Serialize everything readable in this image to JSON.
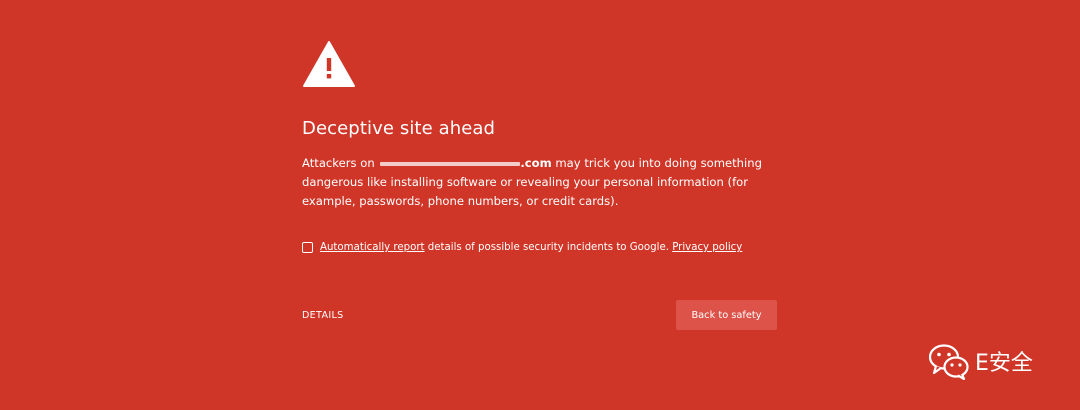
{
  "page": {
    "background_color": "#cf3628",
    "button_color": "#dd5349"
  },
  "warning": {
    "icon": "warning-triangle-icon",
    "mark": "!"
  },
  "title": "Deceptive site ahead",
  "message": {
    "prefix": "Attackers on",
    "domain_suffix": ".com",
    "rest": " may trick you into doing something dangerous like installing software or revealing your personal information (for example, passwords, phone numbers, or credit cards)."
  },
  "report": {
    "link_label": "Automatically report",
    "text": " details of possible security incidents to Google. ",
    "privacy_label": "Privacy policy"
  },
  "actions": {
    "details_label": "DETAILS",
    "back_label": "Back to safety"
  },
  "watermark": {
    "icon": "wechat-icon",
    "text": "E安全"
  }
}
